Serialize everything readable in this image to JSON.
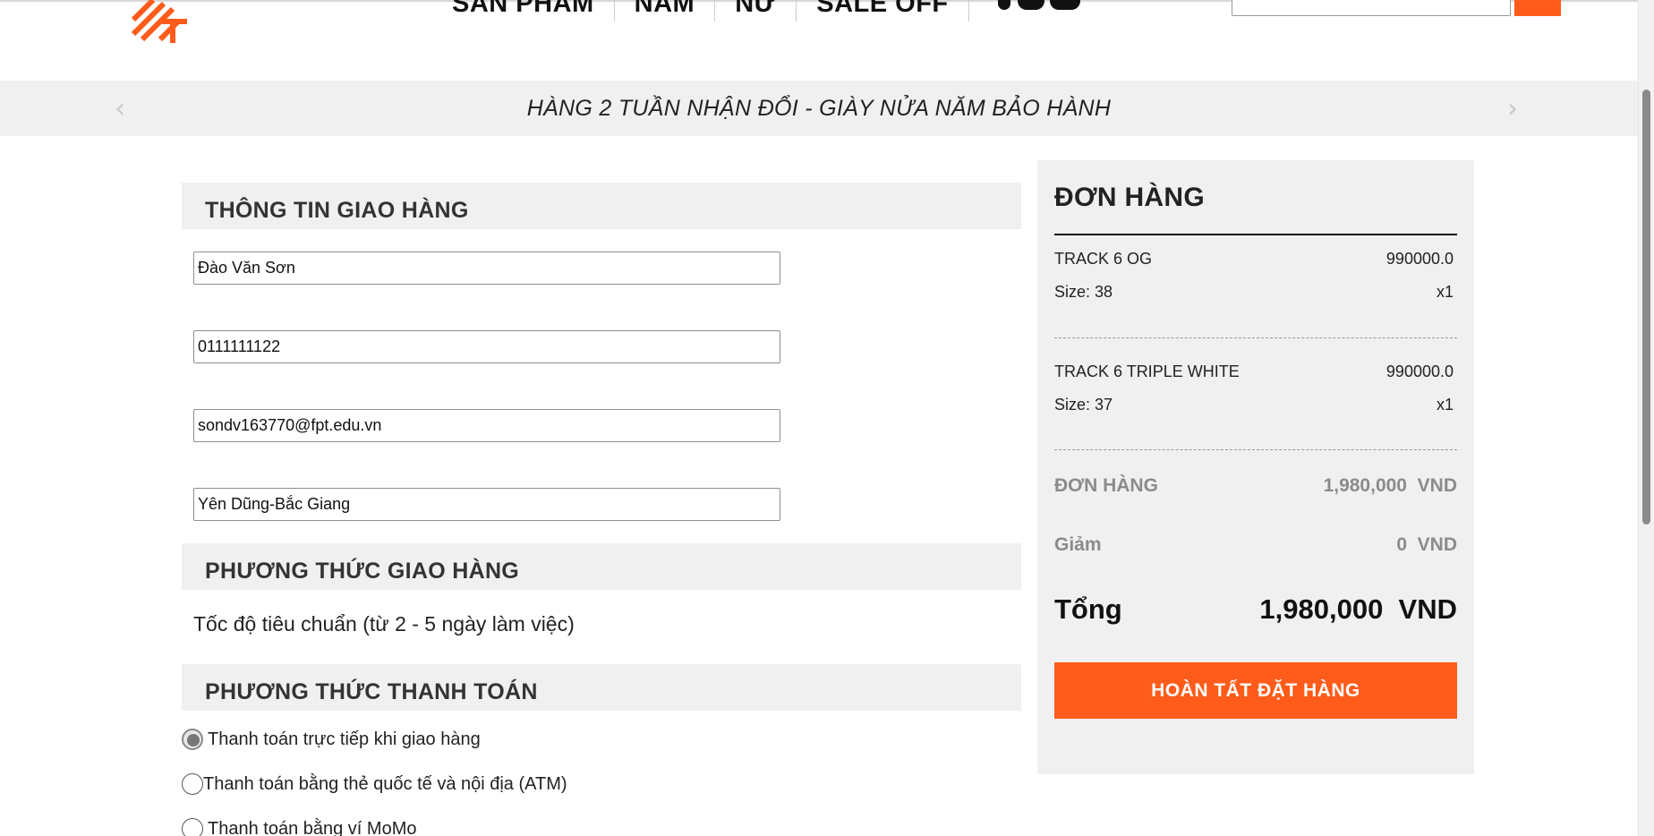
{
  "header": {
    "nav": [
      "SẢN PHẨM",
      "NAM",
      "NỮ",
      "SALE OFF"
    ],
    "search_placeholder": ""
  },
  "colors": {
    "accent": "#ff5b1a",
    "panel_bg": "#f0f0f0"
  },
  "icons": {
    "banner_prev": "chevron-left-icon",
    "banner_next": "chevron-right-icon"
  },
  "banner": {
    "text": "HÀNG 2 TUẦN NHẬN ĐỔI - GIÀY NỬA NĂM BẢO HÀNH"
  },
  "delivery_info": {
    "title": "THÔNG TIN GIAO HÀNG",
    "name": "Đào Văn Sơn",
    "phone": "0111111122",
    "email": "sondv163770@fpt.edu.vn",
    "address": "Yên Dũng-Bắc Giang"
  },
  "shipping": {
    "title": "PHƯƠNG THỨC GIAO HÀNG",
    "method": "Tốc độ tiêu chuẩn (từ 2 - 5 ngày làm việc)"
  },
  "payment": {
    "title": "PHƯƠNG THỨC THANH TOÁN",
    "options": [
      {
        "label": "Thanh toán trực tiếp khi giao hàng",
        "selected": true
      },
      {
        "label": "Thanh toán bằng thẻ quốc tế và nội địa (ATM)",
        "selected": false
      },
      {
        "label": "Thanh toán bằng ví MoMo",
        "selected": false
      }
    ]
  },
  "order": {
    "title": "ĐƠN HÀNG",
    "items": [
      {
        "name": "TRACK 6 OG",
        "price": "990000.0",
        "size": "Size: 38",
        "qty": "x1"
      },
      {
        "name": "TRACK 6 TRIPLE WHITE",
        "price": "990000.0",
        "size": "Size: 37",
        "qty": "x1"
      }
    ],
    "subtotal_label": "ĐƠN HÀNG",
    "subtotal_value": "1,980,000  VND",
    "discount_label": "Giảm",
    "discount_value": "0  VND",
    "total_label": "Tổng",
    "total_value": "1,980,000  VND",
    "checkout_label": "HOÀN TẤT ĐẶT HÀNG"
  }
}
